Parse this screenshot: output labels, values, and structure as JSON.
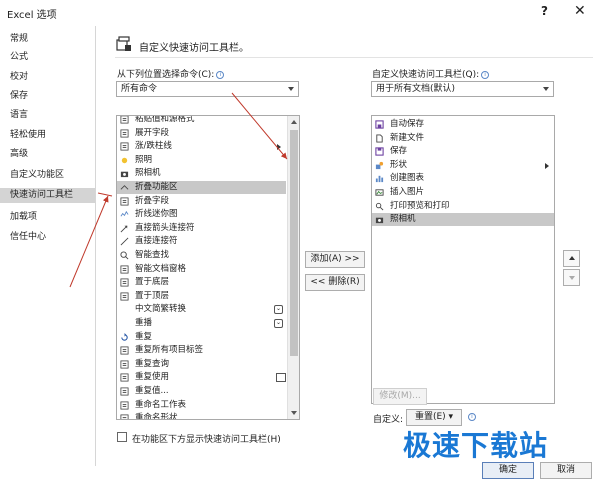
{
  "window": {
    "title": "Excel 选项",
    "help": "?",
    "close": "✕"
  },
  "sidebar": {
    "items": [
      {
        "label": "常规"
      },
      {
        "label": "公式"
      },
      {
        "label": "校对"
      },
      {
        "label": "保存"
      },
      {
        "label": "语言"
      },
      {
        "label": "轻松使用"
      },
      {
        "label": "高级"
      },
      {
        "label": "自定义功能区"
      },
      {
        "label": "快速访问工具栏",
        "active": true
      },
      {
        "label": "加载项"
      },
      {
        "label": "信任中心"
      }
    ]
  },
  "header": {
    "title": "自定义快速访问工具栏。"
  },
  "left": {
    "choose_label": "从下列位置选择命令(C):",
    "choose_value": "所有命令",
    "commands": [
      {
        "label": "粘贴值和源格式",
        "icon": "paste-values-icon"
      },
      {
        "label": "展开字段",
        "icon": "expand-field-icon"
      },
      {
        "label": "涨/跌柱线",
        "icon": "updown-bars-icon",
        "submenu": true
      },
      {
        "label": "照明",
        "icon": "lighting-icon"
      },
      {
        "label": "照相机",
        "icon": "camera-icon"
      },
      {
        "label": "折叠功能区",
        "icon": "collapse-ribbon-icon",
        "selected": true
      },
      {
        "label": "折叠字段",
        "icon": "collapse-field-icon"
      },
      {
        "label": "折线迷你图",
        "icon": "sparkline-icon"
      },
      {
        "label": "直接箭头连接符",
        "icon": "arrow-connector-icon"
      },
      {
        "label": "直接连接符",
        "icon": "straight-connector-icon"
      },
      {
        "label": "智能查找",
        "icon": "smart-lookup-icon"
      },
      {
        "label": "智能文档窗格",
        "icon": "smart-doc-pane-icon"
      },
      {
        "label": "置于底层",
        "icon": "send-to-back-icon"
      },
      {
        "label": "置于顶层",
        "icon": "bring-to-front-icon"
      },
      {
        "label": "中文简繁转换",
        "icon": "",
        "dropdown": true
      },
      {
        "label": "重播",
        "icon": "",
        "dropdown": true
      },
      {
        "label": "重复",
        "icon": "repeat-icon"
      },
      {
        "label": "重复所有项目标签",
        "icon": "repeat-labels-icon"
      },
      {
        "label": "重复查询",
        "icon": "repeat-query-icon"
      },
      {
        "label": "重复使用",
        "icon": "reuse-icon",
        "dropdown_box": true
      },
      {
        "label": "重复值...",
        "icon": "duplicate-values-icon"
      },
      {
        "label": "重命名工作表",
        "icon": "rename-sheet-icon"
      },
      {
        "label": "重命名形状",
        "icon": "rename-shape-icon"
      }
    ],
    "show_below_label": "在功能区下方显示快速访问工具栏(H)"
  },
  "middle": {
    "add_label": "添加(A) >>",
    "remove_label": "<< 删除(R)"
  },
  "right": {
    "customize_label": "自定义快速访问工具栏(Q):",
    "customize_value": "用于所有文档(默认)",
    "items": [
      {
        "label": "自动保存",
        "icon": "autosave-icon"
      },
      {
        "label": "新建文件",
        "icon": "new-file-icon"
      },
      {
        "label": "保存",
        "icon": "save-icon"
      },
      {
        "label": "形状",
        "icon": "shapes-icon",
        "submenu": true
      },
      {
        "label": "创建图表",
        "icon": "chart-icon"
      },
      {
        "label": "插入图片",
        "icon": "picture-icon"
      },
      {
        "label": "打印预览和打印",
        "icon": "print-preview-icon"
      },
      {
        "label": "照相机",
        "icon": "camera-icon",
        "selected": true
      }
    ],
    "modify_label": "修改(M)...",
    "custom_label": "自定义:",
    "reset_label": "重置(E) ▾"
  },
  "footer": {
    "ok_label": "确定",
    "cancel_label": "取消"
  },
  "watermark": "极速下载站",
  "colors": {
    "accent": "#1a78d4",
    "annotation": "#c0392b",
    "selected": "#c8c8c8"
  }
}
